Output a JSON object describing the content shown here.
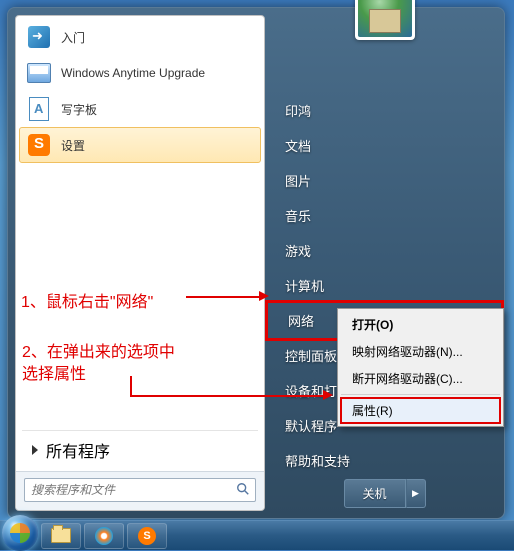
{
  "programs": [
    {
      "label": "入门",
      "icon": "getstarted"
    },
    {
      "label": "Windows Anytime Upgrade",
      "icon": "anytime"
    },
    {
      "label": "写字板",
      "icon": "wordpad"
    },
    {
      "label": "设置",
      "icon": "sogou",
      "hovered": true
    }
  ],
  "all_programs_label": "所有程序",
  "search_placeholder": "搜索程序和文件",
  "right_items": [
    "印鸿",
    "文档",
    "图片",
    "音乐",
    "游戏",
    "计算机",
    "网络",
    "控制面板",
    "设备和打印机",
    "默认程序",
    "帮助和支持"
  ],
  "right_highlight_index": 6,
  "shutdown_label": "关机",
  "context_menu": {
    "open": "打开(O)",
    "map": "映射网络驱动器(N)...",
    "disconnect": "断开网络驱动器(C)...",
    "properties": "属性(R)"
  },
  "annotations": {
    "one": "1、鼠标右击\"网络\"",
    "two": "2、在弹出来的选项中\n选择属性"
  },
  "colors": {
    "highlight_red": "#e00000"
  }
}
